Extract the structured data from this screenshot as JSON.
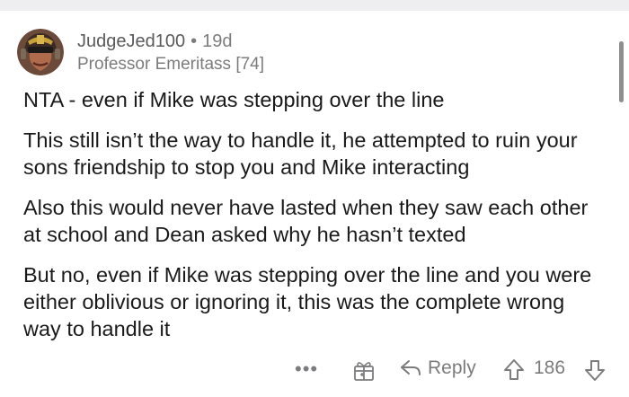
{
  "comment": {
    "username": "JudgeJed100",
    "separator": "•",
    "age": "19d",
    "flair": "Professor Emeritass [74]",
    "paragraphs": [
      "NTA - even if Mike was stepping over the line",
      "This still isn’t the way to handle it, he attempted to ruin your sons friendship to stop you and Mike interacting",
      "Also this would never have lasted when they saw each other at school and Dean asked why he hasn’t texted",
      "But no, even if Mike was stepping over the line and you were either oblivious or ignoring it, this was the complete wrong way to handle it"
    ]
  },
  "actions": {
    "more_label": "•••",
    "award_icon": "gift-icon",
    "reply_icon": "reply-arrow-icon",
    "reply_label": "Reply",
    "upvote_icon": "upvote-arrow-icon",
    "score": "186",
    "downvote_icon": "downvote-arrow-icon"
  },
  "colors": {
    "text": "#1a1a1b",
    "meta": "#7c7c7e",
    "topbar": "#eeeef0"
  }
}
